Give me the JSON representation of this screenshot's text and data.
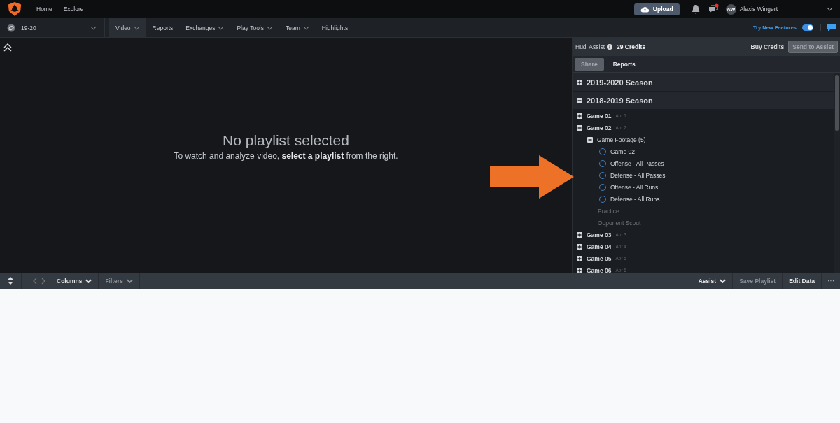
{
  "top_bar": {
    "links": [
      "Home",
      "Explore"
    ],
    "upload": "Upload",
    "notifications_badge": true,
    "user": {
      "initials": "AW",
      "name": "Alexis Wingert"
    }
  },
  "nav": {
    "season": "19-20",
    "items": [
      {
        "label": "Video",
        "dropdown": true,
        "selected": true
      },
      {
        "label": "Reports",
        "dropdown": false,
        "selected": false
      },
      {
        "label": "Exchanges",
        "dropdown": true,
        "selected": false
      },
      {
        "label": "Play Tools",
        "dropdown": true,
        "selected": false
      },
      {
        "label": "Team",
        "dropdown": true,
        "selected": false
      },
      {
        "label": "Highlights",
        "dropdown": false,
        "selected": false
      }
    ],
    "try_new_features": {
      "label": "Try New Features",
      "on": true
    }
  },
  "empty_state": {
    "title": "No playlist selected",
    "message": "To watch and analyze video, **select a playlist** from the right."
  },
  "panel": {
    "assist_label": "Hudl Assist",
    "credits": "29 Credits",
    "buy_credits": "Buy Credits",
    "send_to_assist": {
      "label": "Send to Assist",
      "disabled": true
    },
    "tabs": [
      {
        "label": "Share",
        "selected": true
      },
      {
        "label": "Reports",
        "selected": false
      }
    ],
    "tree": [
      {
        "kind": "season",
        "label": "2019-2020 Season",
        "expanded": false
      },
      {
        "kind": "season",
        "label": "2018-2019 Season",
        "expanded": true,
        "children": [
          {
            "kind": "game",
            "label": "Game 01",
            "date": "Apr 1",
            "expanded": false
          },
          {
            "kind": "game",
            "label": "Game 02",
            "date": "Apr 2",
            "expanded": true,
            "children": [
              {
                "kind": "folder",
                "label": "Game Footage (5)",
                "expanded": true,
                "children": [
                  {
                    "kind": "playlist",
                    "label": "Game 02",
                    "selected": false
                  },
                  {
                    "kind": "playlist",
                    "label": "Offense - All Passes",
                    "selected": false
                  },
                  {
                    "kind": "playlist",
                    "label": "Defense - All Passes",
                    "selected": false
                  },
                  {
                    "kind": "playlist",
                    "label": "Offense - All Runs",
                    "selected": false
                  },
                  {
                    "kind": "playlist",
                    "label": "Defense - All Runs",
                    "selected": false
                  }
                ]
              },
              {
                "kind": "empty_folder",
                "label": "Practice"
              },
              {
                "kind": "empty_folder",
                "label": "Opponent Scout"
              }
            ]
          },
          {
            "kind": "game",
            "label": "Game 03",
            "date": "Apr 3",
            "expanded": false
          },
          {
            "kind": "game",
            "label": "Game 04",
            "date": "Apr 4",
            "expanded": false
          },
          {
            "kind": "game",
            "label": "Game 05",
            "date": "Apr 5",
            "expanded": false
          },
          {
            "kind": "game",
            "label": "Game 06",
            "date": "Apr 6",
            "expanded": false
          }
        ]
      }
    ]
  },
  "toolbar": {
    "left": [
      {
        "label": "Columns",
        "disabled": false
      },
      {
        "label": "Filters",
        "disabled": true
      }
    ],
    "right": [
      {
        "label": "Assist",
        "dropdown": true,
        "disabled": false
      },
      {
        "label": "Save Playlist",
        "dropdown": false,
        "disabled": true
      },
      {
        "label": "Edit Data",
        "dropdown": false,
        "disabled": false
      }
    ],
    "more": "···"
  }
}
